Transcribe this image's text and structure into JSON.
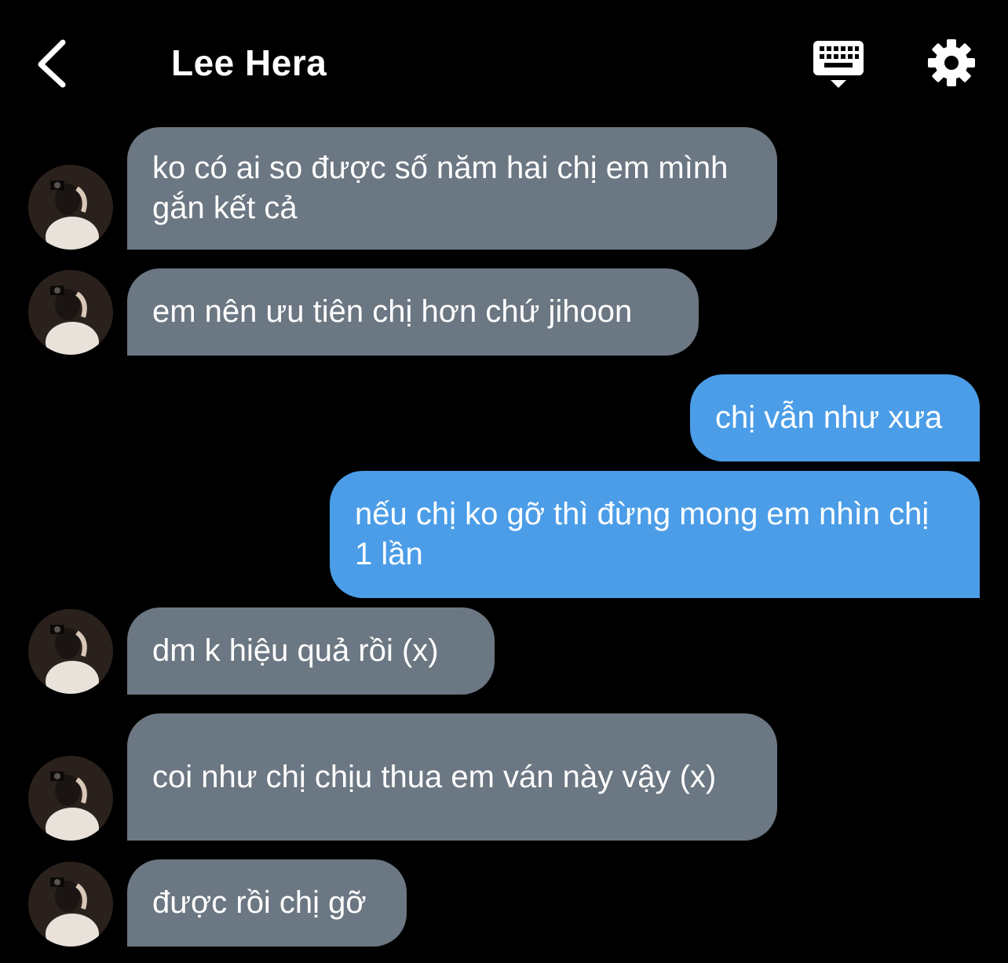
{
  "header": {
    "title": "Lee Hera",
    "back_icon": "chevron-left-icon",
    "keyboard_icon": "keyboard-icon",
    "settings_icon": "gear-icon"
  },
  "colors": {
    "background": "#000000",
    "incoming_bubble": "#6b7782",
    "outgoing_bubble": "#4b9de8",
    "text": "#ffffff"
  },
  "messages": [
    {
      "sender": "other",
      "text": "ko có ai so được số năm hai chị em mình gắn kết cả"
    },
    {
      "sender": "other",
      "text": "em nên ưu tiên chị hơn chứ jihoon"
    },
    {
      "sender": "me",
      "text": "chị vẫn như xưa"
    },
    {
      "sender": "me",
      "text": "nếu chị ko gỡ thì đừng mong em nhìn chị 1 lần"
    },
    {
      "sender": "other",
      "text": "dm k hiệu quả rồi (x)"
    },
    {
      "sender": "other",
      "text": "coi như chị chịu thua em ván này vậy (x)"
    },
    {
      "sender": "other",
      "text": "được rồi chị gỡ"
    }
  ]
}
